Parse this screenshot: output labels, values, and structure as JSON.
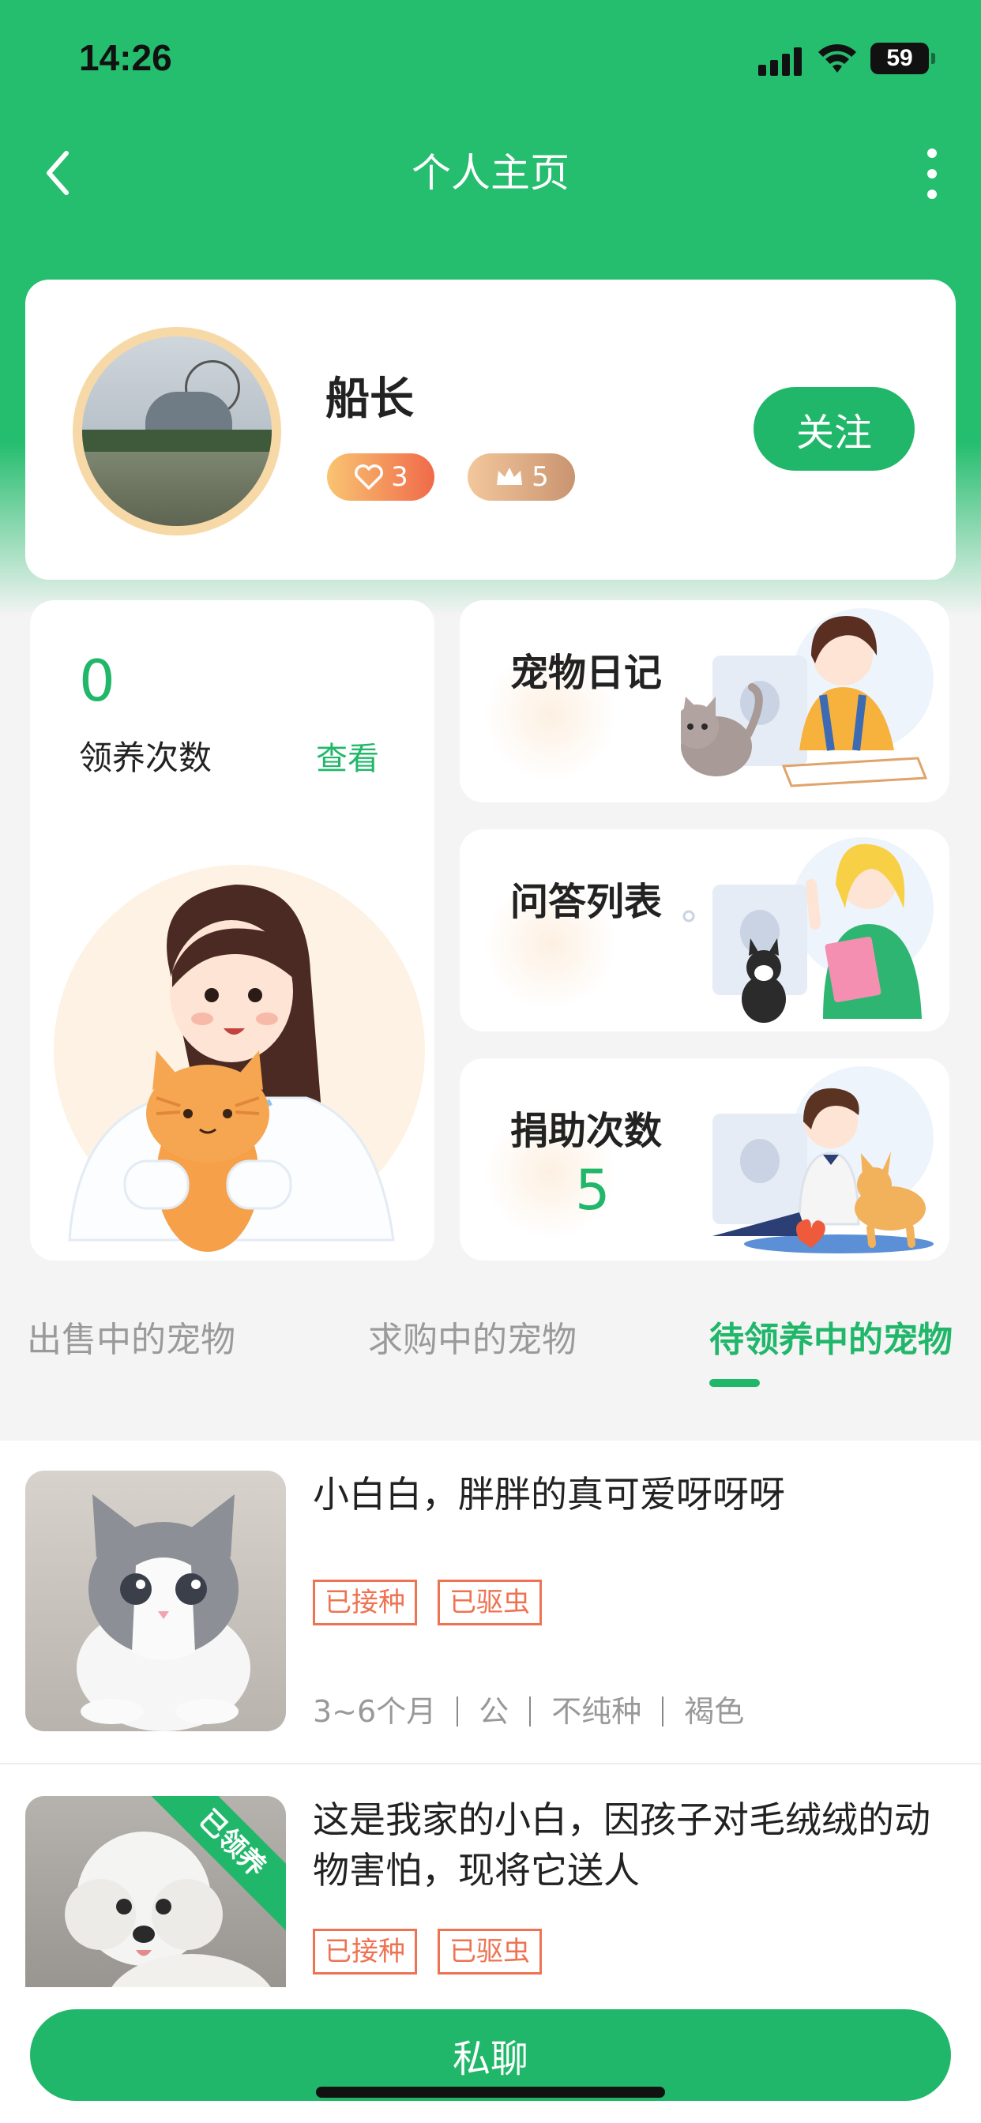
{
  "status_bar": {
    "time": "14:26",
    "battery": "59"
  },
  "nav": {
    "title": "个人主页"
  },
  "profile": {
    "name": "船长",
    "heart_badge": "3",
    "crown_badge": "5",
    "follow_label": "关注"
  },
  "stats": {
    "adopt_count": "0",
    "adopt_label": "领养次数",
    "adopt_link": "查看",
    "diary_title": "宠物日记",
    "qa_title": "问答列表",
    "donate_title": "捐助次数",
    "donate_count": "5"
  },
  "tabs": [
    {
      "label": "出售中的宠物",
      "active": false
    },
    {
      "label": "求购中的宠物",
      "active": false
    },
    {
      "label": "待领养中的宠物",
      "active": true
    }
  ],
  "pets": [
    {
      "title": "小白白，胖胖的真可爱呀呀呀",
      "tags": [
        "已接种",
        "已驱虫"
      ],
      "age": "3~6个月",
      "gender": "公",
      "breed": "不纯种",
      "color": "褐色"
    },
    {
      "title": "这是我家的小白，因孩子对毛绒绒的动物害怕，现将它送人",
      "tags": [
        "已接种",
        "已驱虫"
      ],
      "ribbon": "已领养"
    }
  ],
  "bottom": {
    "chat_label": "私聊"
  },
  "colors": {
    "primary": "#21b76a",
    "tag": "#ee7352",
    "header": "#25bd6e"
  }
}
